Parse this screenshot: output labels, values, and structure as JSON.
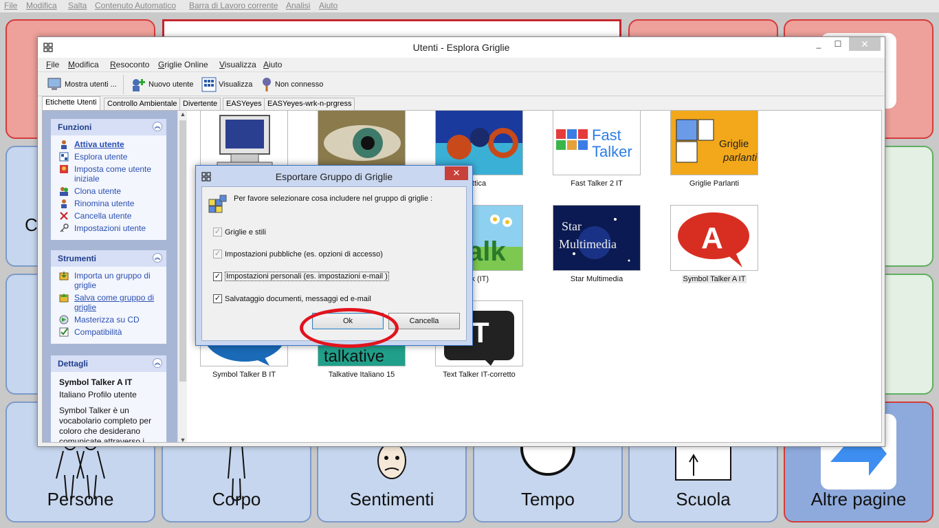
{
  "background_app": {
    "menu": [
      "File",
      "Modifica",
      "Salta",
      "Contenuto Automatico",
      "Barra di Lavoro corrente",
      "Analisi",
      "Aiuto"
    ],
    "bottom_cells": [
      "Persone",
      "Corpo",
      "Sentimenti",
      "Tempo",
      "Scuola",
      "Altre pagine"
    ]
  },
  "window": {
    "title": "Utenti - Esplora Griglie",
    "controls": {
      "minimize": "_",
      "maximize": "☐",
      "close": "✕"
    },
    "menu": [
      "File",
      "Modifica",
      "Resoconto",
      "Griglie Online",
      "Visualizza",
      "Aiuto"
    ],
    "toolbar": {
      "show_users": "Mostra utenti ...",
      "new_user": "Nuovo utente",
      "view": "Visualizza",
      "not_connected": "Non connesso"
    },
    "tabs": [
      "Etichette Utenti",
      "Controllo Ambientale",
      "Divertente",
      "EASYeyes",
      "EASYeyes-wrk-n-prgress"
    ]
  },
  "left_panel": {
    "functions": {
      "title": "Funzioni",
      "items": [
        "Attiva utente",
        "Esplora utente",
        "Imposta come utente iniziale",
        "Clona utente",
        "Rinomina utente",
        "Cancella utente",
        "Impostazioni utente"
      ]
    },
    "tools": {
      "title": "Strumenti",
      "items": [
        "Importa un gruppo di griglie",
        "Salva come gruppo di griglie",
        "Masterizza su CD",
        "Compatibilità"
      ]
    },
    "details": {
      "title": "Dettagli",
      "name": "Symbol Talker A IT",
      "subtitle": "Italiano Profilo utente",
      "description": "Symbol Talker è un vocabolario completo per coloro che desiderano comunicate attraverso i"
    }
  },
  "grid_items": [
    {
      "caption": ""
    },
    {
      "caption": ""
    },
    {
      "caption": "ttica"
    },
    {
      "caption": "Fast Talker 2 IT",
      "thumb_text": [
        "Fast",
        "Talker"
      ]
    },
    {
      "caption": "Griglie Parlanti",
      "thumb_text": [
        "Griglie",
        "parlanti"
      ]
    },
    {
      "caption": "lk (IT)",
      "thumb_text": "alk"
    },
    {
      "caption": "Star Multimedia",
      "thumb_text": [
        "Star",
        "Multimedia"
      ]
    },
    {
      "caption": "Symbol Talker A IT",
      "thumb_text": "A"
    },
    {
      "caption": "Symbol Talker B IT"
    },
    {
      "caption": "Talkative Italiano 15",
      "thumb_text": "talkative"
    },
    {
      "caption": "Text Talker IT-corretto",
      "thumb_text": "T"
    }
  ],
  "dialog": {
    "title": "Esportare Gruppo di Griglie",
    "close": "✕",
    "prompt": "Per favore selezionare cosa includere nel gruppo di griglie :",
    "options": [
      {
        "label": "Griglie e stili",
        "checked": true,
        "enabled": false
      },
      {
        "label": "Impostazioni pubbliche (es. opzioni di accesso)",
        "checked": true,
        "enabled": false
      },
      {
        "label": "Impostazioni personali (es. impostazioni e-mail )",
        "checked": true,
        "enabled": true
      },
      {
        "label": "Salvataggio documenti, messaggi ed e-mail",
        "checked": true,
        "enabled": true
      }
    ],
    "ok": "Ok",
    "cancel": "Cancella"
  },
  "colors": {
    "annotation": "#e1141d",
    "link": "#2a4fb1",
    "panel_bg": "#a8b6d6"
  }
}
